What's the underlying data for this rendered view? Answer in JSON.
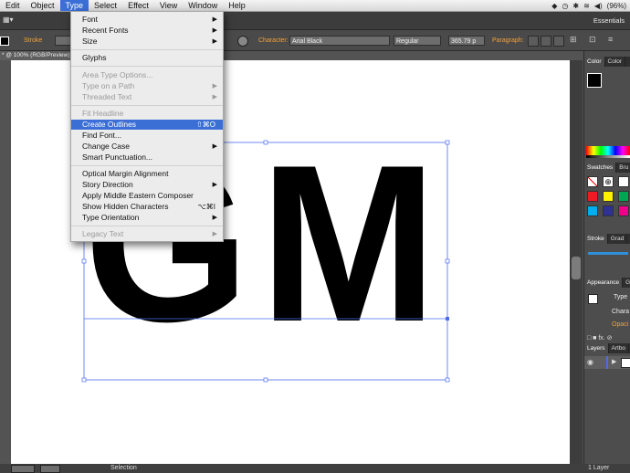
{
  "menubar": {
    "items": [
      "Edit",
      "Object",
      "Type",
      "Select",
      "Effect",
      "View",
      "Window",
      "Help"
    ],
    "active": "Type",
    "battery": "(96%)"
  },
  "appbar": {
    "workspace": "Essentials"
  },
  "control_bar": {
    "stroke_label": "Stroke",
    "character_label": "Character:",
    "font_name": "Arial Black",
    "font_style": "Regular",
    "font_size": "365.79 p",
    "paragraph_label": "Paragraph:"
  },
  "doc_tab": {
    "title": "* @ 100% (RGB/Preview)"
  },
  "canvas": {
    "text": "GM"
  },
  "type_menu": {
    "items": [
      {
        "label": "Font",
        "submenu": true
      },
      {
        "label": "Recent Fonts",
        "submenu": true
      },
      {
        "label": "Size",
        "submenu": true
      },
      {
        "label": "Glyphs"
      },
      {
        "label": "Area Type Options...",
        "disabled": true
      },
      {
        "label": "Type on a Path",
        "disabled": true,
        "submenu": true
      },
      {
        "label": "Threaded Text",
        "disabled": true,
        "submenu": true
      },
      {
        "label": "Fit Headline",
        "disabled": true
      },
      {
        "label": "Create Outlines",
        "shortcut": "⇧⌘O",
        "highlighted": true
      },
      {
        "label": "Find Font..."
      },
      {
        "label": "Change Case",
        "submenu": true
      },
      {
        "label": "Smart Punctuation..."
      },
      {
        "label": "Optical Margin Alignment"
      },
      {
        "label": "Story Direction",
        "submenu": true
      },
      {
        "label": "Apply Middle Eastern Composer"
      },
      {
        "label": "Show Hidden Characters",
        "shortcut": "⌥⌘I"
      },
      {
        "label": "Type Orientation",
        "submenu": true
      },
      {
        "label": "Legacy Text",
        "disabled": true,
        "submenu": true
      }
    ]
  },
  "panels": {
    "color_tabs": [
      "Color",
      "Color"
    ],
    "swatches_tabs": [
      "Swatches",
      "Bru"
    ],
    "stroke_tabs": [
      "Stroke",
      "Grad"
    ],
    "appearance_tabs": [
      "Appearance",
      "G"
    ],
    "appearance_type": "Type",
    "appearance_chars": "Chara",
    "appearance_opacity": "Opaci",
    "layers_tabs": [
      "Layers",
      "Artbo"
    ],
    "layers_count": "1 Layer"
  },
  "status": {
    "tool": "Selection"
  },
  "colors": {
    "highlight": "#3b6fd6",
    "orange": "#f3a13a",
    "selection": "#4a6cf0"
  }
}
